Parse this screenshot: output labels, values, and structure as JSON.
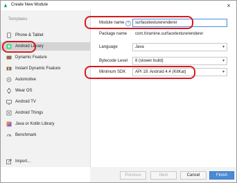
{
  "window": {
    "title": "Create New Module",
    "close_glyph": "×"
  },
  "sidebar": {
    "section_title": "Templates",
    "items": [
      {
        "label": "Phone & Tablet",
        "icon": "phone-tablet-icon"
      },
      {
        "label": "Android Library",
        "icon": "android-library-icon",
        "selected": true
      },
      {
        "label": "Dynamic Feature",
        "icon": "dynamic-feature-icon"
      },
      {
        "label": "Instant Dynamic Feature",
        "icon": "instant-dynamic-feature-icon"
      },
      {
        "label": "Automotive",
        "icon": "automotive-icon"
      },
      {
        "label": "Wear OS",
        "icon": "wear-os-icon"
      },
      {
        "label": "Android TV",
        "icon": "android-tv-icon"
      },
      {
        "label": "Android Things",
        "icon": "android-things-icon"
      },
      {
        "label": "Java or Kotlin Library",
        "icon": "java-kotlin-library-icon"
      },
      {
        "label": "Benchmark",
        "icon": "benchmark-icon"
      }
    ],
    "import_label": "Import..."
  },
  "form": {
    "module_name": {
      "label": "Module name",
      "value": "surfacetexturerenderer"
    },
    "package_name": {
      "label": "Package name",
      "value": "com.hiramine.surfacetexturerenderer"
    },
    "language": {
      "label": "Language",
      "value": "Java"
    },
    "bytecode_level": {
      "label": "Bytecode Level",
      "value": "8 (slower build)"
    },
    "minimum_sdk": {
      "label": "Minimum SDK",
      "value": "API 19: Android 4.4 (KitKat)"
    }
  },
  "footer": {
    "previous": "Previous",
    "next": "Next",
    "cancel": "Cancel",
    "finish": "Finish"
  },
  "colors": {
    "accent": "#4a8bd6",
    "annotation": "#d8191f",
    "android_green": "#3ddc84"
  }
}
